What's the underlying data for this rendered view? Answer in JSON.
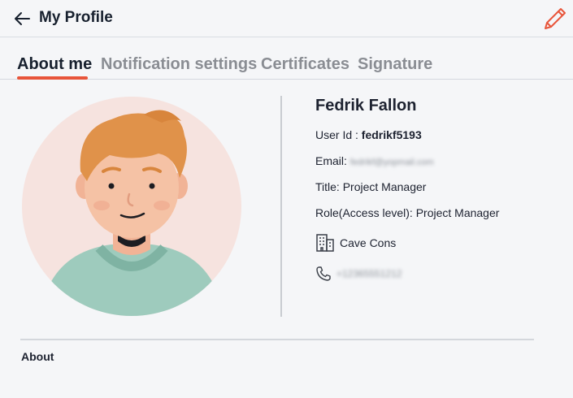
{
  "header": {
    "title": "My Profile",
    "back_icon": "arrow-left-icon",
    "edit_icon": "pencil-icon"
  },
  "tabs": [
    {
      "label": "About me",
      "active": true
    },
    {
      "label": "Notification settings",
      "active": false
    },
    {
      "label": "Certificates",
      "active": false
    },
    {
      "label": "Signature",
      "active": false
    }
  ],
  "profile": {
    "name": "Fedrik Fallon",
    "user_id_label": "User Id : ",
    "user_id": "fedrikf5193",
    "email_label": "Email: ",
    "email": "fedrikf@yopmail.com",
    "title_text": "Title: Project Manager",
    "role_text": "Role(Access level): Project Manager",
    "company": "Cave Cons",
    "company_icon": "building-icon",
    "phone": "+12365551212",
    "phone_icon": "phone-icon"
  },
  "about": {
    "label": "About"
  },
  "colors": {
    "accent": "#e8553a",
    "background": "#f5f6f8",
    "avatar_bg": "#f6e3df",
    "hair": "#e0924a",
    "shirt": "#9ecbbd"
  }
}
